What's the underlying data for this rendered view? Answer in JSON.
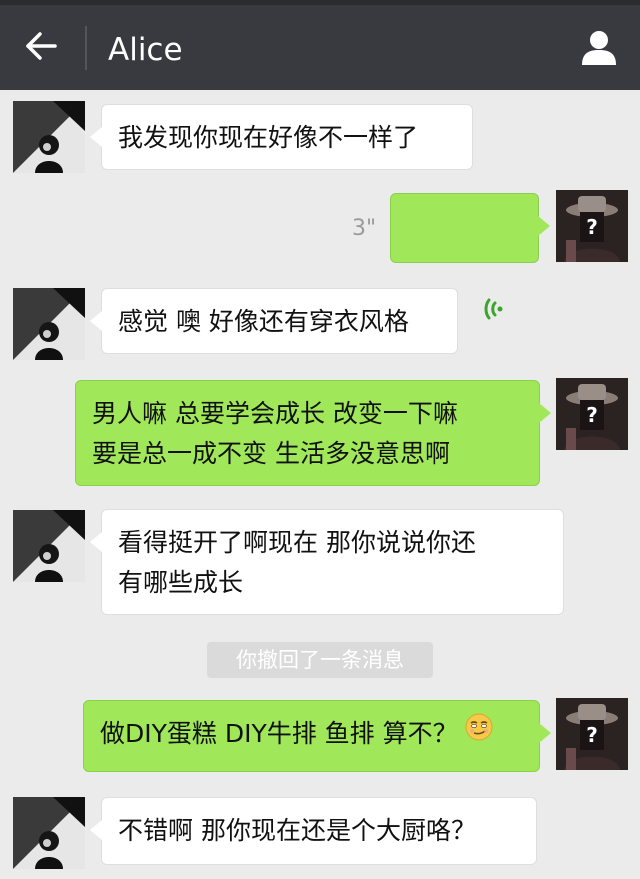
{
  "header": {
    "title": "Alice",
    "back_icon": "arrow-left-icon",
    "profile_icon": "person-icon",
    "bar_color": "#393a3f"
  },
  "colors": {
    "background": "#ebebeb",
    "incoming_bubble": "#ffffff",
    "outgoing_bubble": "#a0e75a",
    "system_notice": "#dadada"
  },
  "messages": [
    {
      "sender": "Alice",
      "direction": "in",
      "type": "text",
      "text": "我发现你现在好像不一样了"
    },
    {
      "sender": "me",
      "direction": "out",
      "type": "voice",
      "duration": "3\""
    },
    {
      "sender": "Alice",
      "direction": "in",
      "type": "text",
      "text": "感觉 噢 好像还有穿衣风格"
    },
    {
      "sender": "me",
      "direction": "out",
      "type": "text",
      "text": "男人嘛 总要学会成长 改变一下嘛\n要是总一成不变 生活多没意思啊"
    },
    {
      "sender": "Alice",
      "direction": "in",
      "type": "text",
      "text": "看得挺开了啊现在 那你说说你还\n有哪些成长"
    },
    {
      "type": "system",
      "text": "你撤回了一条消息"
    },
    {
      "sender": "me",
      "direction": "out",
      "type": "text",
      "text": "做DIY蛋糕 DIY牛排 鱼排 算不？",
      "emoji": "smirk-emoji"
    },
    {
      "sender": "Alice",
      "direction": "in",
      "type": "text",
      "text": "不错啊 那你现在还是个大厨咯？"
    }
  ]
}
